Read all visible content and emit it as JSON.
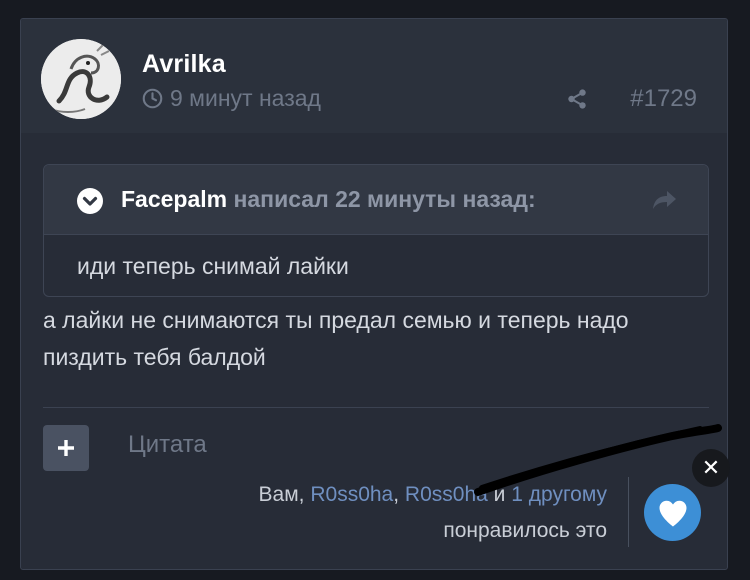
{
  "post": {
    "author": "Avrilka",
    "time": "9 минут назад",
    "number": "#1729",
    "body": "а лайки не снимаются ты предал семью и теперь надо пиздить тебя балдой"
  },
  "quote": {
    "author": "Facepalm",
    "action": "написал 22 минуты назад:",
    "text": "иди теперь снимай лайки"
  },
  "footer": {
    "cite_label": "Цитата",
    "likes": {
      "prefix": "Вам,",
      "user1": "R0ss0ha",
      "comma": ",",
      "user2": "R0ss0ha",
      "and": "и",
      "other": "1 другому",
      "suffix": "понравилось это"
    }
  },
  "icons": {
    "clock": "clock-icon",
    "share": "share-icon",
    "quote_toggle": "chevron-down-icon",
    "quote_goto": "reply-arrow-icon",
    "plus": "plus-icon",
    "heart": "heart-icon",
    "close": "close-icon"
  },
  "colors": {
    "background": "#171a21",
    "card": "#272c37",
    "header": "#2b313c",
    "accent_blue": "#3d8fd6",
    "link": "#6f8fc0",
    "muted": "#6f7888"
  }
}
